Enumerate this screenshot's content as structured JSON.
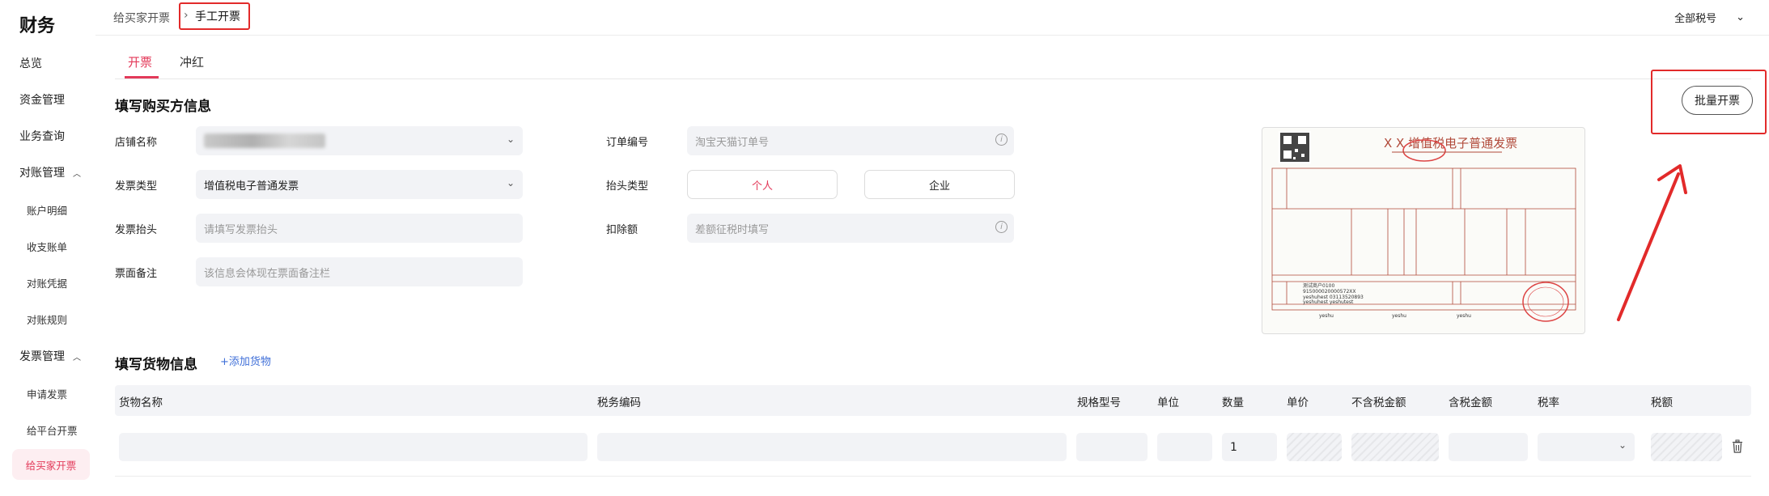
{
  "app": {
    "title": "财务"
  },
  "sidebar": {
    "overview": "总览",
    "funds": "资金管理",
    "biz_query": "业务查询",
    "reconcile": {
      "label": "对账管理",
      "items": [
        "账户明细",
        "收支账单",
        "对账凭据",
        "对账规则"
      ]
    },
    "invoice": {
      "label": "发票管理",
      "items": [
        "申请发票",
        "给平台开票",
        "给买家开票"
      ],
      "active": "给买家开票"
    }
  },
  "breadcrumb": {
    "parent": "给买家开票",
    "sep": "›",
    "current": "手工开票"
  },
  "topbar": {
    "tax_selector": "全部税号",
    "tax_chevron": "⌄"
  },
  "tabs": [
    {
      "label": "开票",
      "active": true
    },
    {
      "label": "冲红",
      "active": false
    }
  ],
  "buyer": {
    "title": "填写购买方信息",
    "shop_name_label": "店铺名称",
    "invoice_type_label": "发票类型",
    "invoice_type_value": "增值税电子普通发票",
    "invoice_title_label": "发票抬头",
    "invoice_title_placeholder": "请填写发票抬头",
    "remark_label": "票面备注",
    "remark_placeholder": "该信息会体现在票面备注栏",
    "order_no_label": "订单编号",
    "order_no_placeholder": "淘宝天猫订单号",
    "header_type_label": "抬头类型",
    "header_type_options": [
      "个人",
      "企业"
    ],
    "header_type_selected": "个人",
    "deduction_label": "扣除额",
    "deduction_placeholder": "差额征税时填写"
  },
  "batch_button": "批量开票",
  "invoice_preview": {
    "heading": "X X 增值税电子普通发票",
    "rows": [
      "测试商户0100",
      "915000020000572XX",
      "yeshuhest 03113520893",
      "yeshuhest yeshutest"
    ],
    "footer": [
      "yeshu",
      "yeshu",
      "yeshu"
    ]
  },
  "goods": {
    "title": "填写货物信息",
    "add_label": "+添加货物",
    "columns": [
      "货物名称",
      "税务编码",
      "规格型号",
      "单位",
      "数量",
      "单价",
      "不含税金额",
      "含税金额",
      "税率",
      "税额"
    ],
    "row": {
      "quantity": "1"
    }
  },
  "colors": {
    "accent": "#e33a5a",
    "highlight": "#e22a2a",
    "link": "#3f6fd8"
  }
}
